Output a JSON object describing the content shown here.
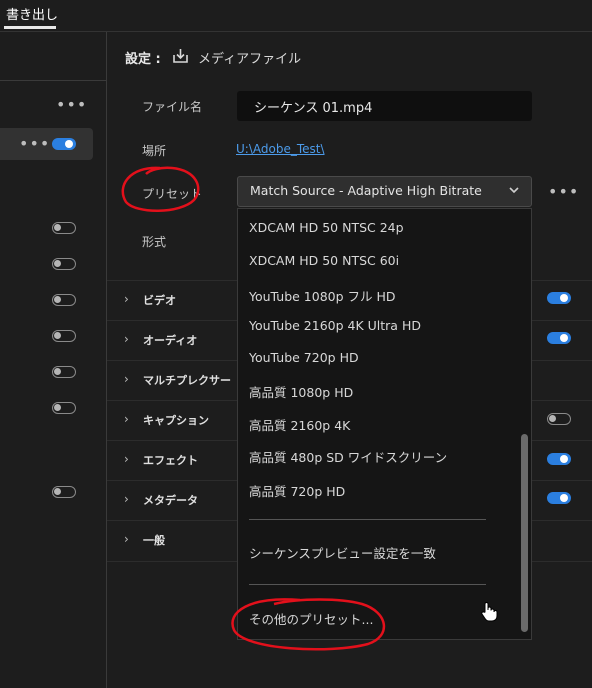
{
  "topbar": {
    "tab_label": "書き出し"
  },
  "settings": {
    "title": "設定 :",
    "subtitle": "メディアファイル",
    "filename_label": "ファイル名",
    "filename_value": "シーケンス 01.mp4",
    "location_label": "場所",
    "location_value": "U:\\Adobe_Test\\",
    "preset_label": "プリセット",
    "preset_value": "Match Source - Adaptive High Bitrate",
    "format_label": "形式"
  },
  "sections": [
    {
      "label": "ビデオ",
      "toggle": "on"
    },
    {
      "label": "オーディオ",
      "toggle": "on"
    },
    {
      "label": "マルチプレクサー",
      "toggle": "none"
    },
    {
      "label": "キャプション",
      "toggle": "off"
    },
    {
      "label": "エフェクト",
      "toggle": "on"
    },
    {
      "label": "メタデータ",
      "toggle": "on"
    },
    {
      "label": "一般",
      "toggle": "none"
    }
  ],
  "dropdown": {
    "items": [
      "XDCAM HD 50 NTSC 24p",
      "XDCAM HD 50 NTSC 60i",
      "YouTube 1080p フル HD",
      "YouTube 2160p 4K Ultra HD",
      "YouTube 720p HD",
      "高品質 1080p HD",
      "高品質 2160p 4K",
      "高品質 480p SD ワイドスクリーン",
      "高品質 720p HD"
    ],
    "sequence_preview": "シーケンスプレビュー設定を一致",
    "more_presets": "その他のプリセット..."
  },
  "icons": {
    "export": "export-icon",
    "more": "more-options-icon",
    "chevron": "chevron-down-icon",
    "cursor": "hand-cursor-icon"
  },
  "colors": {
    "accent": "#2b7fe0",
    "link": "#4c9bea",
    "annotation": "#e3101b"
  }
}
